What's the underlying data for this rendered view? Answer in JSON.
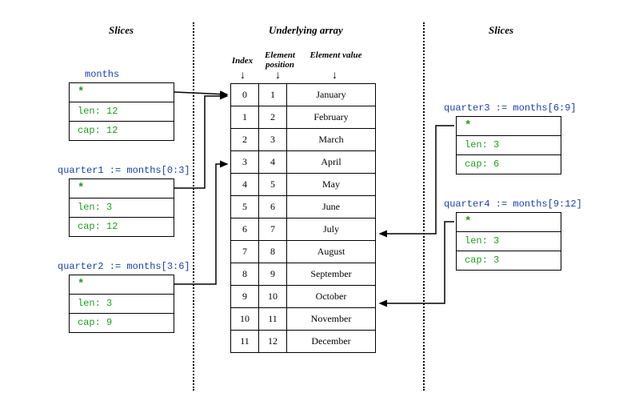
{
  "headings": {
    "left": "Slices",
    "center": "Underlying array",
    "right": "Slices"
  },
  "column_headers": {
    "index": "Index",
    "position": "Element position",
    "value": "Element value"
  },
  "array": {
    "rows": [
      {
        "idx": "0",
        "pos": "1",
        "val": "January"
      },
      {
        "idx": "1",
        "pos": "2",
        "val": "February"
      },
      {
        "idx": "2",
        "pos": "3",
        "val": "March"
      },
      {
        "idx": "3",
        "pos": "4",
        "val": "April"
      },
      {
        "idx": "4",
        "pos": "5",
        "val": "May"
      },
      {
        "idx": "5",
        "pos": "6",
        "val": "June"
      },
      {
        "idx": "6",
        "pos": "7",
        "val": "July"
      },
      {
        "idx": "7",
        "pos": "8",
        "val": "August"
      },
      {
        "idx": "8",
        "pos": "9",
        "val": "September"
      },
      {
        "idx": "9",
        "pos": "10",
        "val": "October"
      },
      {
        "idx": "10",
        "pos": "11",
        "val": "November"
      },
      {
        "idx": "11",
        "pos": "12",
        "val": "December"
      }
    ]
  },
  "slices": {
    "months": {
      "label": "months",
      "ptr": "*",
      "len": "len: 12",
      "cap": "cap: 12"
    },
    "quarter1": {
      "label": "quarter1 := months[0:3]",
      "ptr": "*",
      "len": "len: 3",
      "cap": "cap: 12"
    },
    "quarter2": {
      "label": "quarter2 := months[3:6]",
      "ptr": "*",
      "len": "len: 3",
      "cap": "cap: 9"
    },
    "quarter3": {
      "label": "quarter3 := months[6:9]",
      "ptr": "*",
      "len": "len: 3",
      "cap": "cap: 6"
    },
    "quarter4": {
      "label": "quarter4 := months[9:12]",
      "ptr": "*",
      "len": "len: 3",
      "cap": "cap: 3"
    }
  }
}
